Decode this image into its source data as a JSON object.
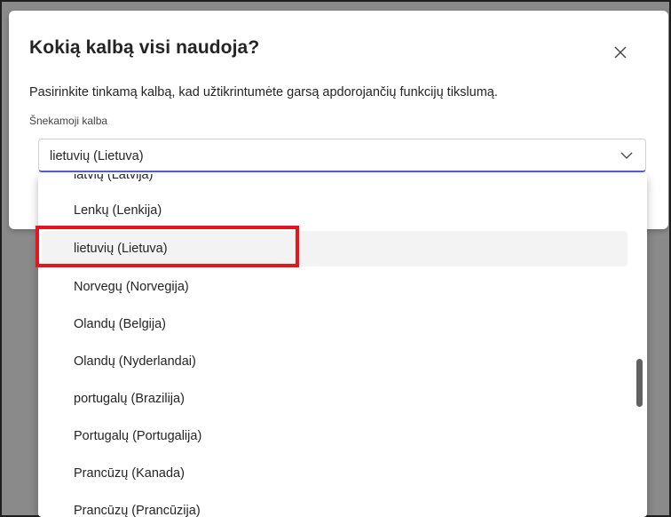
{
  "dialog": {
    "title": "Kokią kalbą visi naudoja?",
    "description": "Pasirinkite tinkamą kalbą, kad užtikrintumėte garsą apdorojančių funkcijų tikslumą.",
    "field_label": "Šnekamoji kalba",
    "selected_value": "lietuvių (Lietuva)",
    "close_icon": "close-icon",
    "chevron_icon": "chevron-down-icon"
  },
  "dropdown": {
    "options": [
      {
        "label": "latvių (Latvija)"
      },
      {
        "label": "Lenkų (Lenkija)"
      },
      {
        "label": "lietuvių (Lietuva)",
        "selected": true
      },
      {
        "label": "Norvegų (Norvegija)"
      },
      {
        "label": "Olandų (Belgija)"
      },
      {
        "label": "Olandų (Nyderlandai)"
      },
      {
        "label": "portugalų (Brazilija)"
      },
      {
        "label": "Portugalų (Portugalija)"
      },
      {
        "label": "Prancūzų (Kanada)"
      },
      {
        "label": "Prancūzų (Prancūzija)"
      }
    ]
  },
  "colors": {
    "accent": "#5b5fc7",
    "highlight": "#e8131b",
    "selected_bg": "#f3f3f3"
  }
}
